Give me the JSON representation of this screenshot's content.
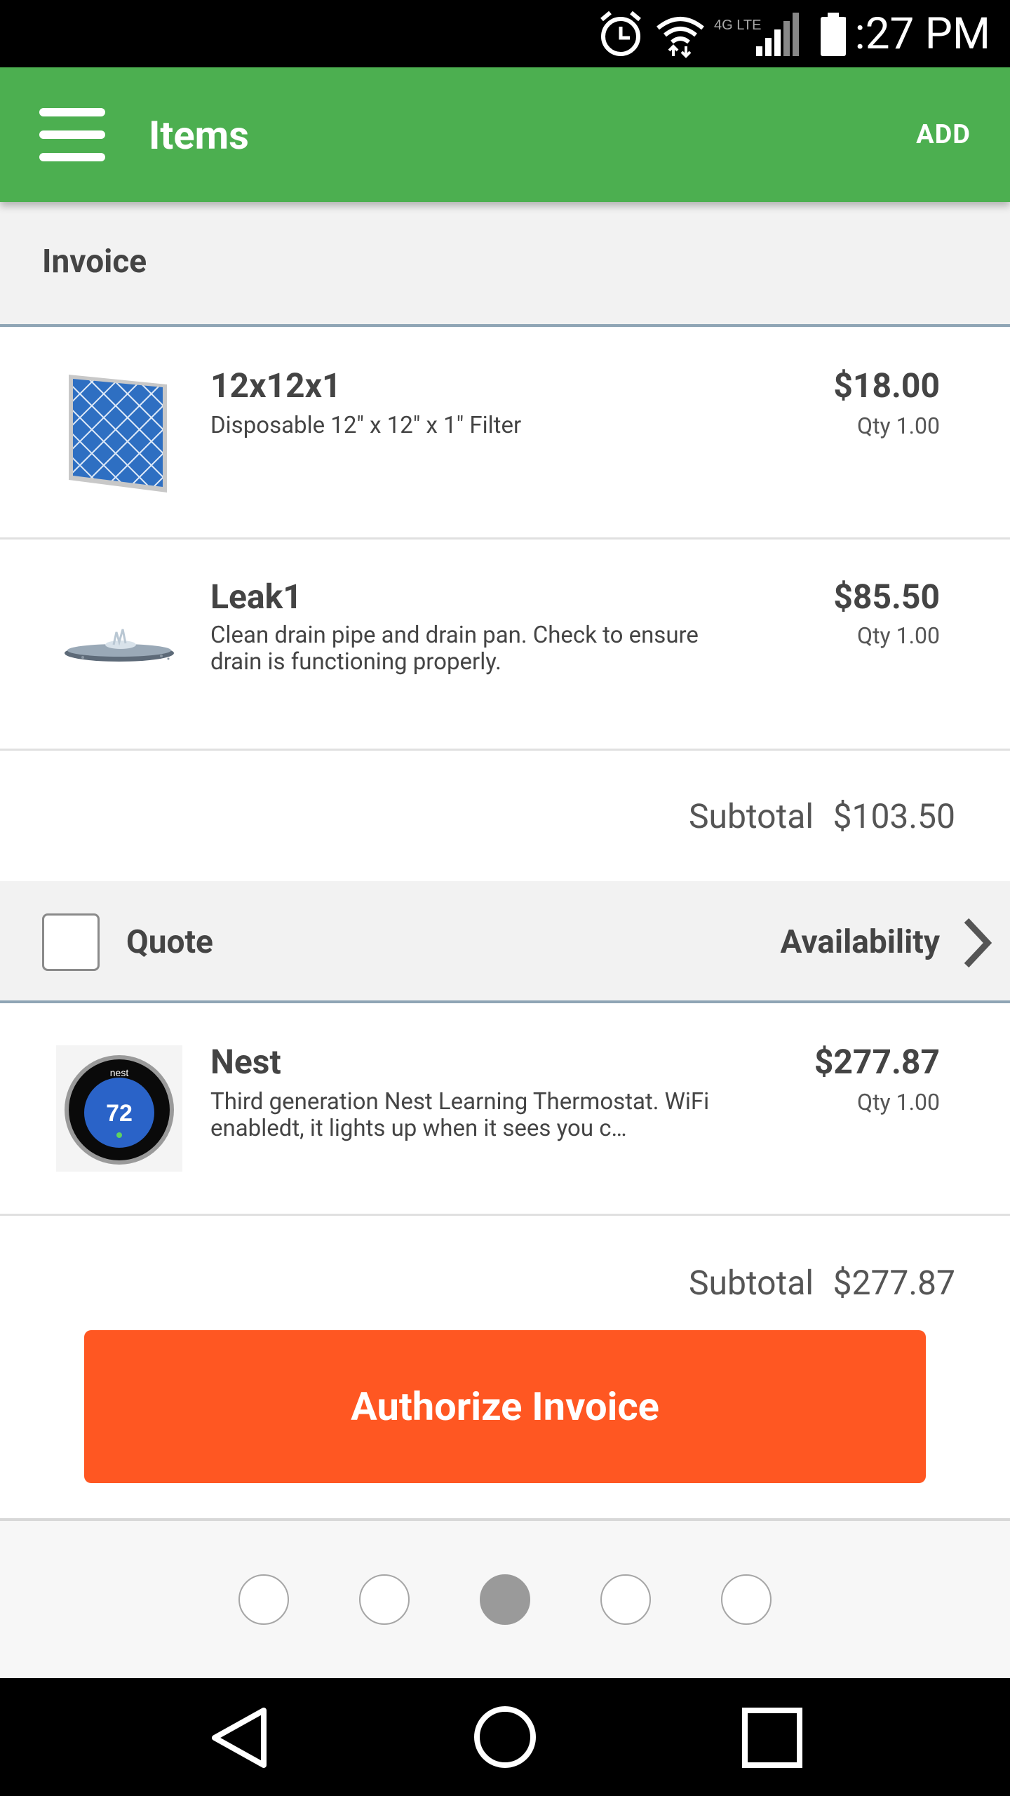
{
  "status_bar": {
    "time": "1:27 PM",
    "network": "4G LTE",
    "icons": [
      "alarm-icon",
      "wifi-icon",
      "signal-icon",
      "battery-icon"
    ]
  },
  "app_bar": {
    "title": "Items",
    "action_label": "ADD",
    "color": "#4caf50"
  },
  "sections": [
    {
      "title": "Invoice",
      "items": [
        {
          "name": "12x12x1",
          "description": "Disposable 12\" x 12\" x 1\" Filter",
          "price": "$18.00",
          "qty": "Qty 1.00",
          "thumb": "air-filter-icon"
        },
        {
          "name": "Leak1",
          "description": "Clean drain pipe and drain pan. Check to ensure drain is functioning properly.",
          "price": "$85.50",
          "qty": "Qty 1.00",
          "thumb": "drain-pan-icon"
        }
      ],
      "subtotal_label": "Subtotal",
      "subtotal_value": "$103.50"
    },
    {
      "title": "Quote",
      "checkbox_checked": false,
      "link_label": "Availability",
      "items": [
        {
          "name": "Nest",
          "description": "Third generation Nest Learning Thermostat. WiFi enabledt, it lights up when it sees you c…",
          "price": "$277.87",
          "qty": "Qty 1.00",
          "thumb": "thermostat-icon",
          "thumb_brand": "nest",
          "thumb_reading": "72"
        }
      ],
      "subtotal_label": "Subtotal",
      "subtotal_value": "$277.87"
    }
  ],
  "authorize_button": {
    "label": "Authorize Invoice",
    "color": "#ff5722"
  },
  "pager": {
    "count": 5,
    "active_index": 2
  },
  "nav_bar": {
    "buttons": [
      "back-icon",
      "home-icon",
      "recents-icon"
    ]
  }
}
